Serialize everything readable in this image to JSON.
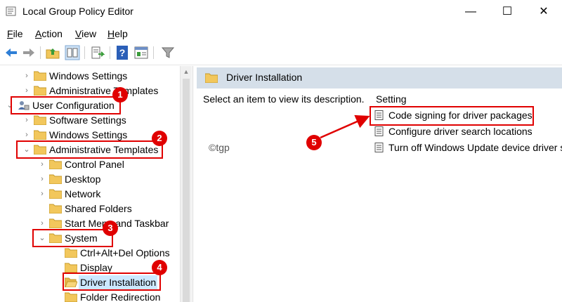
{
  "window": {
    "title": "Local Group Policy Editor",
    "minimize": "—",
    "maximize": "☐",
    "close": "✕"
  },
  "menu": [
    {
      "label": "File",
      "accel": "F",
      "rest": "ile"
    },
    {
      "label": "Action",
      "accel": "A",
      "rest": "ction"
    },
    {
      "label": "View",
      "accel": "V",
      "rest": "iew"
    },
    {
      "label": "Help",
      "accel": "H",
      "rest": "elp"
    }
  ],
  "toolbar": [
    "back-icon",
    "forward-icon",
    "up-folder-icon",
    "show-hide-tree-icon",
    "export-list-icon",
    "help-icon",
    "properties-icon",
    "filter-icon"
  ],
  "tree": [
    {
      "label": "Windows Settings",
      "chevron": "›"
    },
    {
      "label": "Administrative Templates",
      "chevron": "›"
    },
    {
      "label": "User Configuration",
      "chevron": "⌄"
    },
    {
      "label": "Software Settings",
      "chevron": "›"
    },
    {
      "label": "Windows Settings",
      "chevron": "›"
    },
    {
      "label": "Administrative Templates",
      "chevron": "⌄"
    },
    {
      "label": "Control Panel",
      "chevron": "›"
    },
    {
      "label": "Desktop",
      "chevron": "›"
    },
    {
      "label": "Network",
      "chevron": "›"
    },
    {
      "label": "Shared Folders",
      "chevron": ""
    },
    {
      "label": "Start Menu and Taskbar",
      "chevron": "›"
    },
    {
      "label": "System",
      "chevron": "⌄"
    },
    {
      "label": "Ctrl+Alt+Del Options",
      "chevron": ""
    },
    {
      "label": "Display",
      "chevron": ""
    },
    {
      "label": "Driver Installation",
      "chevron": ""
    },
    {
      "label": "Folder Redirection",
      "chevron": ""
    }
  ],
  "right_pane": {
    "header": "Driver Installation",
    "description": "Select an item to view its description.",
    "column_header": "Setting",
    "settings": [
      "Code signing for driver packages",
      "Configure driver search locations",
      "Turn off Windows Update device driver se"
    ],
    "watermark": "©tgp"
  },
  "badges": [
    "1",
    "2",
    "3",
    "4",
    "5"
  ],
  "colors": {
    "accent_red": "#e00000",
    "header_band": "#d5dfe9",
    "selection": "#cce8ff",
    "folder": "#f2c75c"
  }
}
